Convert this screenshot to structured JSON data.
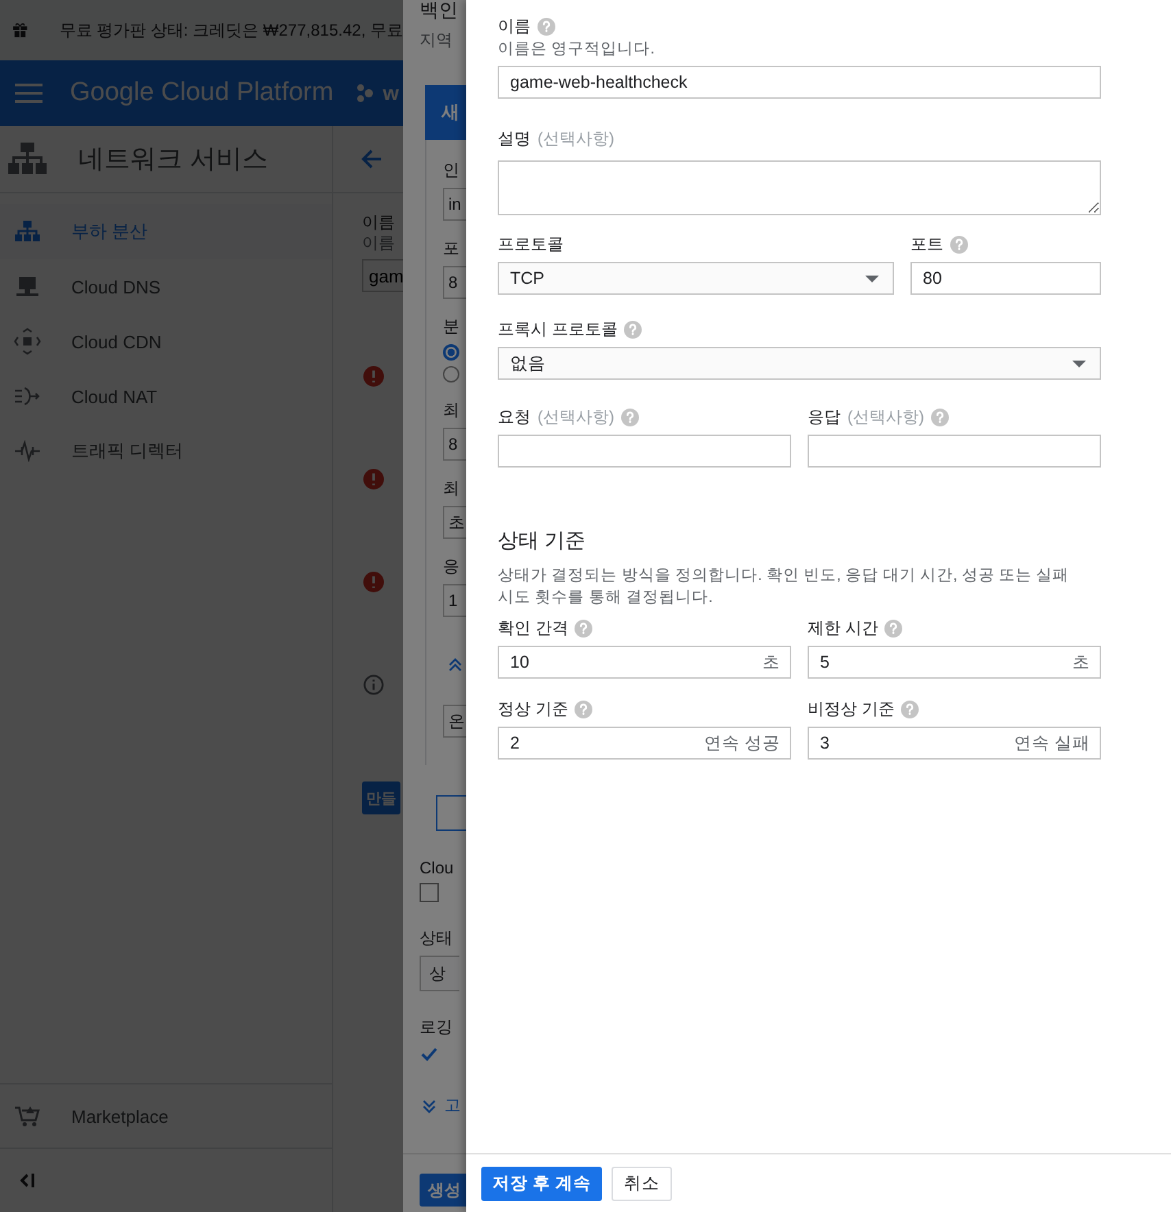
{
  "trial_banner": {
    "text": "무료 평가판 상태: 크레딧은 ₩277,815.42, 무료"
  },
  "header": {
    "product_name": "Google Cloud Platform",
    "project_selector": "w"
  },
  "sidebar": {
    "title": "네트워크 서비스",
    "items": [
      {
        "label": "부하 분산",
        "selected": true
      },
      {
        "label": "Cloud DNS",
        "selected": false
      },
      {
        "label": "Cloud CDN",
        "selected": false
      },
      {
        "label": "Cloud NAT",
        "selected": false
      },
      {
        "label": "트래픽 디렉터",
        "selected": false
      }
    ],
    "footer_item": "Marketplace"
  },
  "page": {
    "name_label": "이름",
    "name_hint": "이름",
    "name_value": "gam",
    "notices": [
      {
        "kind": "error"
      },
      {
        "kind": "error"
      },
      {
        "kind": "error"
      },
      {
        "kind": "info"
      }
    ],
    "create_button": "만들"
  },
  "backend_panel": {
    "title": "백인",
    "subtitle": "지역",
    "card": {
      "header": "새",
      "rows": [
        {
          "kind": "label",
          "text": "인"
        },
        {
          "kind": "field",
          "value": "in"
        },
        {
          "kind": "label",
          "text": "포"
        },
        {
          "kind": "field",
          "value": "8"
        },
        {
          "kind": "label",
          "text": "분"
        },
        {
          "kind": "radio",
          "selected": true
        },
        {
          "kind": "radio",
          "selected": false
        },
        {
          "kind": "label",
          "text": "최"
        },
        {
          "kind": "field",
          "value": "8"
        },
        {
          "kind": "label",
          "text": "최"
        },
        {
          "kind": "field",
          "value": "초"
        },
        {
          "kind": "label",
          "text": "응"
        },
        {
          "kind": "field",
          "value": "1"
        },
        {
          "kind": "chevron"
        },
        {
          "kind": "field",
          "value": "온"
        }
      ]
    },
    "cdn_label": "Clou",
    "cdn_checkbox": {
      "checked": false
    },
    "health_label": "상태",
    "health_select": "상",
    "logging_label": "로깅",
    "logging_checkbox": {
      "checked": true
    },
    "advanced_link": "고",
    "create_button": "생성"
  },
  "health_check_panel": {
    "name": {
      "label": "이름",
      "hint": "이름은 영구적입니다.",
      "value": "game-web-healthcheck"
    },
    "description": {
      "label": "설명",
      "optional": "(선택사항)"
    },
    "protocol": {
      "label": "프로토콜",
      "value": "TCP"
    },
    "port": {
      "label": "포트",
      "value": "80"
    },
    "proxy_protocol": {
      "label": "프록시 프로토콜",
      "value": "없음"
    },
    "request": {
      "label": "요청",
      "optional": "(선택사항)"
    },
    "response": {
      "label": "응답",
      "optional": "(선택사항)"
    },
    "criteria": {
      "title": "상태 기준",
      "description": "상태가 결정되는 방식을 정의합니다. 확인 빈도, 응답 대기 시간, 성공 또는 실패 시도 횟수를 통해 결정됩니다.",
      "fields": [
        {
          "label": "확인 간격",
          "value": "10",
          "unit": "초"
        },
        {
          "label": "제한 시간",
          "value": "5",
          "unit": "초"
        },
        {
          "label": "정상 기준",
          "value": "2",
          "unit": "연속 성공"
        },
        {
          "label": "비정상 기준",
          "value": "3",
          "unit": "연속 실패"
        }
      ]
    },
    "buttons": {
      "primary": "저장 후 계속",
      "secondary": "취소"
    }
  }
}
